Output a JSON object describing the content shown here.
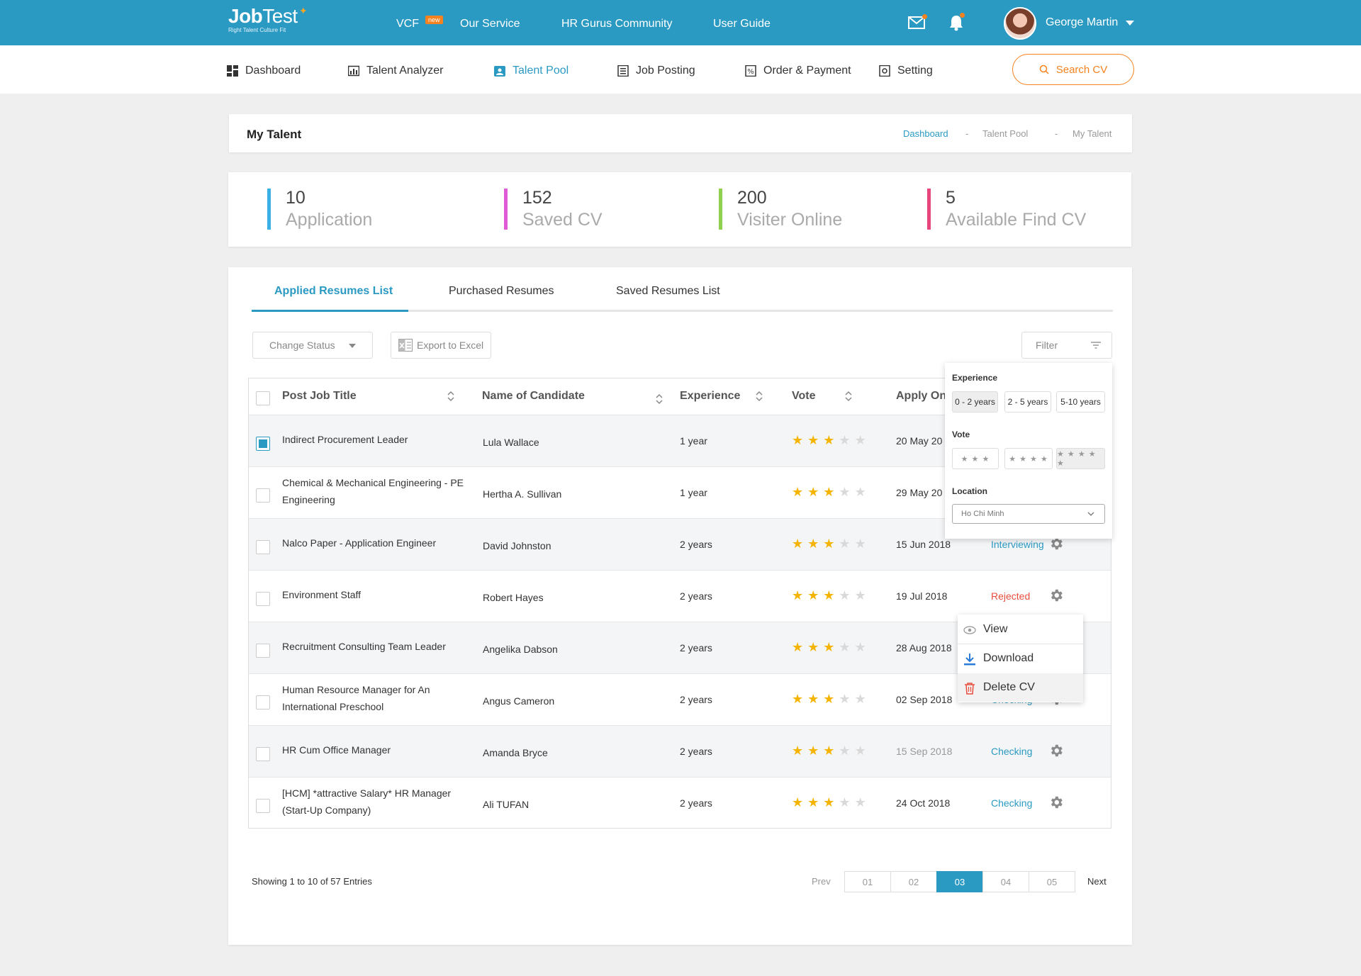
{
  "brand": {
    "name_bold": "Job",
    "name_light": "Test",
    "tagline": "Right Talent Culture Fit"
  },
  "topnav": {
    "items": [
      "VCF",
      "Our Service",
      "HR Gurus Community",
      "User Guide"
    ],
    "new_badge": "new"
  },
  "user": {
    "name": "George Martin"
  },
  "subnav": {
    "items": [
      "Dashboard",
      "Talent Analyzer",
      "Talent Pool",
      "Job Posting",
      "Order & Payment",
      "Setting"
    ],
    "active": "Talent Pool",
    "search_label": "Search CV"
  },
  "page": {
    "title": "My Talent",
    "breadcrumb": [
      "Dashboard",
      "Talent Pool",
      "My Talent"
    ],
    "separator": "-"
  },
  "stats": [
    {
      "value": "10",
      "label": "Application",
      "color": "#3ab0e6"
    },
    {
      "value": "152",
      "label": "Saved CV",
      "color": "#e05ad6"
    },
    {
      "value": "200",
      "label": "Visiter Online",
      "color": "#8fd14f"
    },
    {
      "value": "5",
      "label": "Available Find CV",
      "color": "#e8457c"
    }
  ],
  "tabs": [
    "Applied Resumes List",
    "Purchased Resumes",
    "Saved Resumes List"
  ],
  "toolbar": {
    "change_status": "Change Status",
    "export": "Export to Excel",
    "filter": "Filter"
  },
  "table": {
    "headers": [
      "Post Job Title",
      "Name of Candidate",
      "Experience",
      "Vote",
      "Apply On"
    ],
    "rows": [
      {
        "title": [
          "Indirect Procurement Leader"
        ],
        "name": "Lula Wallace",
        "exp": "1 year",
        "stars": 3,
        "date": "20 May 20",
        "status": "",
        "checked": true
      },
      {
        "title": [
          "Chemical & Mechanical Engineering - PE",
          "Engineering"
        ],
        "name": "Hertha A. Sullivan",
        "exp": "1 year",
        "stars": 3,
        "date": "29 May 20",
        "status": "",
        "checked": false
      },
      {
        "title": [
          "Nalco Paper - Application Engineer"
        ],
        "name": "David Johnston",
        "exp": "2 years",
        "stars": 3,
        "date": "15 Jun 2018",
        "status": "Interviewing",
        "checked": false
      },
      {
        "title": [
          "Environment Staff"
        ],
        "name": "Robert Hayes",
        "exp": "2 years",
        "stars": 3,
        "date": "19 Jul 2018",
        "status": "Rejected",
        "checked": false
      },
      {
        "title": [
          "Recruitment Consulting Team Leader"
        ],
        "name": "Angelika Dabson",
        "exp": "2 years",
        "stars": 3,
        "date": "28 Aug 2018",
        "status": "",
        "checked": false
      },
      {
        "title": [
          "Human Resource Manager for An",
          "International Preschool"
        ],
        "name": "Angus Cameron",
        "exp": "2 years",
        "stars": 3,
        "date": "02 Sep 2018",
        "status": "Checking",
        "checked": false
      },
      {
        "title": [
          "HR Cum Office Manager"
        ],
        "name": "Amanda Bryce",
        "exp": "2 years",
        "stars": 3,
        "date": "15 Sep 2018",
        "status": "Checking",
        "checked": false
      },
      {
        "title": [
          "[HCM] *attractive Salary* HR Manager",
          "(Start-Up Company)"
        ],
        "name": "Ali TUFAN",
        "exp": "2 years",
        "stars": 3,
        "date": "24 Oct 2018",
        "status": "Checking",
        "checked": false
      }
    ],
    "max_stars": 5
  },
  "action_menu": [
    "View",
    "Download",
    "Delete CV"
  ],
  "filter_panel": {
    "experience_label": "Experience",
    "experience_options": [
      "0 - 2 years",
      "2 - 5 years",
      "5-10 years"
    ],
    "vote_label": "Vote",
    "vote_options": [
      3,
      4,
      5
    ],
    "location_label": "Location",
    "location_value": "Ho Chi Minh"
  },
  "pagination": {
    "summary": "Showing 1 to 10 of 57 Entries",
    "prev": "Prev",
    "next": "Next",
    "pages": [
      "01",
      "02",
      "03",
      "04",
      "05"
    ],
    "current": "03"
  },
  "colors": {
    "primary": "#2b9ac3",
    "accent": "#f5821f",
    "star": "#f5b400",
    "star_empty": "#d9d9d9",
    "rejected": "#e84c3d",
    "checking": "#2b9ac3"
  }
}
